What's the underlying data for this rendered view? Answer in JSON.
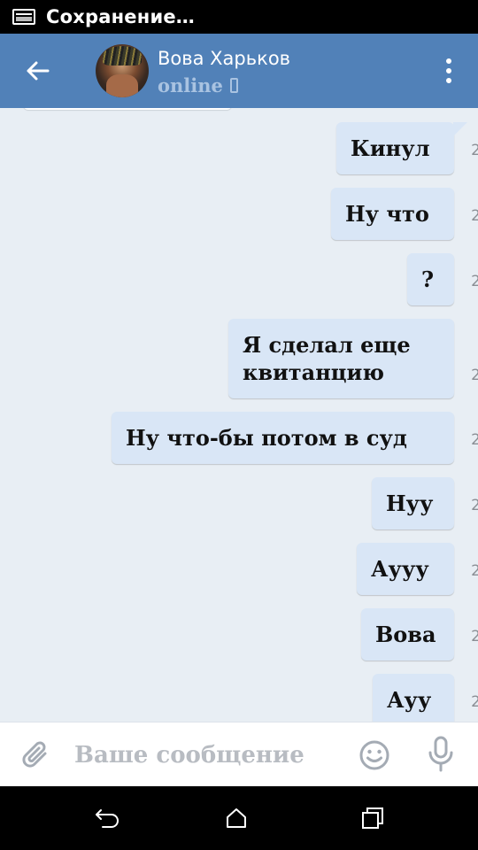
{
  "status_bar": {
    "notification_icon": "screenshot-icon",
    "text": "Сохранение…"
  },
  "header": {
    "back_icon": "arrow-left-icon",
    "contact_name": "Вова Харьков",
    "contact_status": "online",
    "status_device_icon": "phone-icon",
    "menu_icon": "more-vertical-icon",
    "accent_color": "#5181b8"
  },
  "messages": [
    {
      "text": "Кинул",
      "time": "2",
      "outgoing": true
    },
    {
      "text": "Ну что",
      "time": "2",
      "outgoing": true
    },
    {
      "text": "?",
      "time": "2",
      "outgoing": true
    },
    {
      "text": "Я сделал еще квитанцию",
      "time": "2",
      "outgoing": true
    },
    {
      "text": "Ну что-бы потом в суд",
      "time": "2",
      "outgoing": true
    },
    {
      "text": "Нуу",
      "time": "2",
      "outgoing": true
    },
    {
      "text": "Аууу",
      "time": "2",
      "outgoing": true
    },
    {
      "text": "Вова",
      "time": "2",
      "outgoing": true
    },
    {
      "text": "Ауу",
      "time": "2",
      "outgoing": true
    }
  ],
  "composer": {
    "placeholder": "Ваше сообщение",
    "value": "",
    "attach_icon": "paperclip-icon",
    "emoji_icon": "smiley-icon",
    "mic_icon": "microphone-icon"
  },
  "nav_bar": {
    "back_icon": "nav-back-icon",
    "home_icon": "nav-home-icon",
    "recents_icon": "nav-recents-icon"
  },
  "colors": {
    "outgoing_bubble": "#d9e6f6",
    "chat_background": "#e8eef4",
    "status_secondary": "#a9c3e1"
  }
}
